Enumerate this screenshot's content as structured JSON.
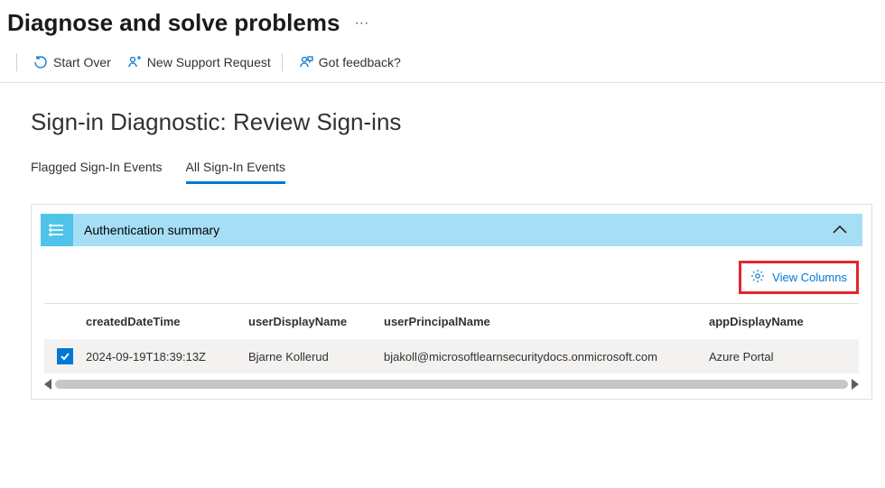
{
  "header": {
    "title": "Diagnose and solve problems",
    "more": "···"
  },
  "toolbar": {
    "start_over": "Start Over",
    "new_support": "New Support Request",
    "feedback": "Got feedback?"
  },
  "subtitle": "Sign-in Diagnostic: Review Sign-ins",
  "tabs": {
    "flagged": "Flagged Sign-In Events",
    "all": "All Sign-In Events"
  },
  "panel": {
    "auth_summary": "Authentication summary",
    "view_columns": "View Columns"
  },
  "table": {
    "columns": {
      "created": "createdDateTime",
      "userDisplay": "userDisplayName",
      "userPrincipal": "userPrincipalName",
      "appDisplay": "appDisplayName"
    },
    "rows": [
      {
        "checked": true,
        "created": "2024-09-19T18:39:13Z",
        "userDisplay": "Bjarne Kollerud",
        "userPrincipal": "bjakoll@microsoftlearnsecuritydocs.onmicrosoft.com",
        "appDisplay": "Azure Portal"
      }
    ]
  },
  "colors": {
    "accent": "#0078d4",
    "highlight": "#e3262d",
    "band": "#a6dff5"
  }
}
